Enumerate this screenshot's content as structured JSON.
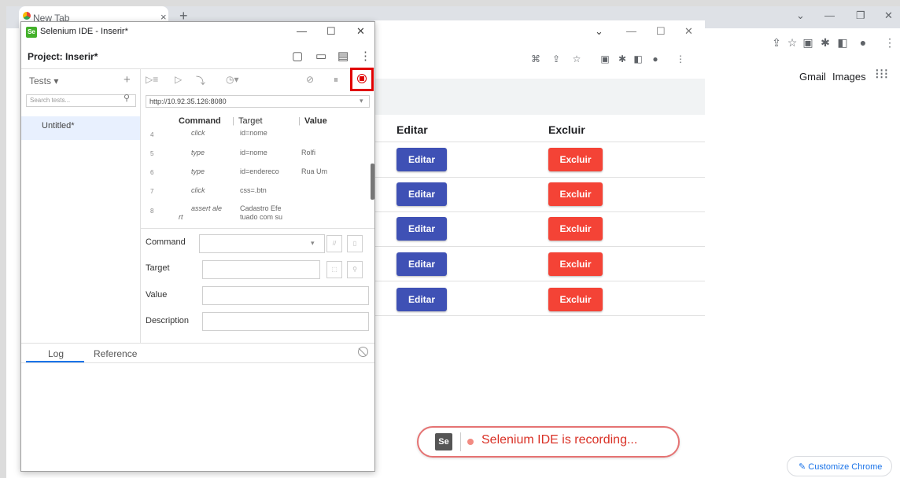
{
  "outer": {
    "tab_title": "New Tab",
    "gmail": "Gmail",
    "images": "Images",
    "customize": "Customize Chrome"
  },
  "app_page": {
    "columns": [
      "Editar",
      "Excluir"
    ],
    "rows": [
      {
        "edit": "Editar",
        "delete": "Excluir"
      },
      {
        "edit": "Editar",
        "delete": "Excluir"
      },
      {
        "edit": "Editar",
        "delete": "Excluir"
      },
      {
        "edit": "Editar",
        "delete": "Excluir"
      },
      {
        "edit": "Editar",
        "delete": "Excluir"
      }
    ],
    "edit_color": "#3f51b5",
    "delete_color": "#f44336"
  },
  "ide": {
    "title": "Selenium IDE - Inserir*",
    "logo": "Se",
    "project_label": "Project:  Inserir*",
    "tests_header": "Tests",
    "search_placeholder": "Search tests...",
    "test_item": "Untitled*",
    "base_url": "http://10.92.35.126:8080",
    "grid_headers": {
      "command": "Command",
      "target": "Target",
      "value": "Value"
    },
    "commands": [
      {
        "num": "4",
        "command": "click",
        "target": "id=nome",
        "value": ""
      },
      {
        "num": "5",
        "command": "type",
        "target": "id=nome",
        "value": "Rolfi"
      },
      {
        "num": "6",
        "command": "type",
        "target": "id=endereco",
        "value": "Rua Um"
      },
      {
        "num": "7",
        "command": "click",
        "target": "css=.btn",
        "value": ""
      },
      {
        "num": "8",
        "command": "assert ale",
        "command_wrap": "rt",
        "target": "Cadastro Efe",
        "target_wrap": "tuado com su",
        "value": ""
      }
    ],
    "fields": {
      "command": "Command",
      "target": "Target",
      "value": "Value",
      "description": "Description"
    },
    "log_tabs": {
      "log": "Log",
      "reference": "Reference"
    },
    "record_color": "#e00000"
  },
  "recording": {
    "logo": "Se",
    "text": "Selenium IDE is recording..."
  }
}
